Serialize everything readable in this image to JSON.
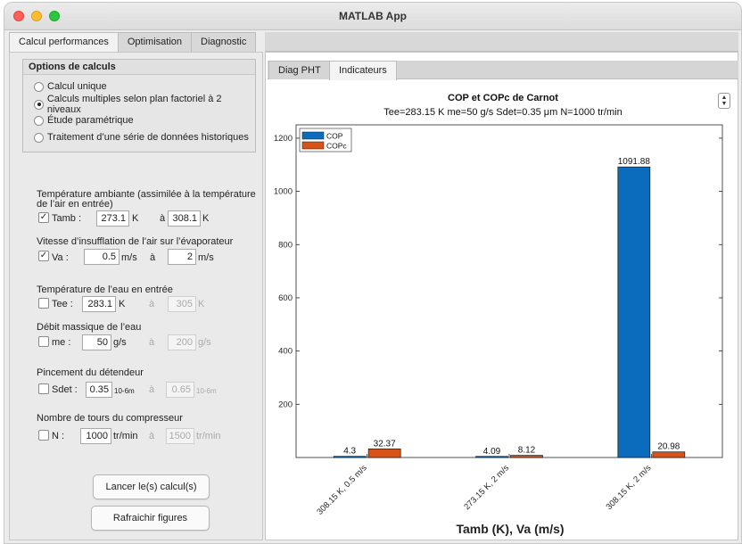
{
  "window": {
    "title": "MATLAB App"
  },
  "main_tabs": [
    {
      "label": "Calcul performances",
      "active": true
    },
    {
      "label": "Optimisation",
      "active": false
    },
    {
      "label": "Diagnostic",
      "active": false
    }
  ],
  "options": {
    "title": "Options de calculs",
    "items": [
      {
        "label": "Calcul unique",
        "selected": false
      },
      {
        "label": "Calculs multiples selon plan factoriel à 2 niveaux",
        "selected": true
      },
      {
        "label": "Étude paramétrique",
        "selected": false
      },
      {
        "label": "Traitement d’une série de données historiques",
        "selected": false
      }
    ]
  },
  "params": {
    "tamb": {
      "section": "Température ambiante (assimilée à la température",
      "section2": "de l’air en entrée)",
      "check": "Tamb :",
      "checked": true,
      "from": "273.1",
      "unit": "K",
      "a": "à",
      "to": "308.1"
    },
    "va": {
      "section": "Vitesse d’insufflation de l’air sur l’évaporateur",
      "check": "Va :",
      "checked": true,
      "from": "0.5",
      "unit": "m/s",
      "a": "à",
      "to": "2"
    },
    "tee": {
      "section": "Température de l’eau en entrée",
      "check": "Tee :",
      "checked": false,
      "from": "283.1",
      "unit": "K",
      "a": "à",
      "to": "305"
    },
    "me": {
      "section": "Débit massique de l’eau",
      "check": "me :",
      "checked": false,
      "from": "50",
      "unit": "g/s",
      "a": "à",
      "to": "200"
    },
    "sdet": {
      "section": "Pincement du détendeur",
      "check": "Sdet :",
      "checked": false,
      "from": "0.35",
      "unit": "10-6m",
      "a": "à",
      "to": "0.65"
    },
    "n": {
      "section": "Nombre de tours du compresseur",
      "check": "N :",
      "checked": false,
      "from": "1000",
      "unit": "tr/min",
      "a": "à",
      "to": "1500"
    }
  },
  "buttons": {
    "run": "Lancer le(s) calcul(s)",
    "refresh": "Rafraichir figures"
  },
  "sub_tabs": [
    {
      "label": "Diag PHT",
      "active": false
    },
    {
      "label": "Indicateurs",
      "active": true
    }
  ],
  "colors": {
    "cop": "#0b6cbd",
    "copc": "#d95319"
  },
  "chart_data": {
    "type": "bar",
    "title": "COP et COPc de Carnot",
    "subtitle": "Tee=283.15 K me=50 g/s Sdet=0.35 μm N=1000 tr/min",
    "xlabel": "Tamb (K), Va (m/s)",
    "ylabel": "",
    "categories": [
      "308.15 K, 0.5 m/s",
      "273.15 K, 2 m/s",
      "308.15 K, 2 m/s"
    ],
    "series": [
      {
        "name": "COP",
        "values": [
          4.3,
          4.09,
          1091.88
        ],
        "labels": [
          "4.3",
          "4.09",
          "1091.88"
        ]
      },
      {
        "name": "COPc",
        "values": [
          32.37,
          8.12,
          20.98
        ],
        "labels": [
          "32.37",
          "8.12",
          "20.98"
        ]
      }
    ],
    "yticks": [
      200,
      400,
      600,
      800,
      1000,
      1200
    ],
    "ylim": [
      0,
      1250
    ],
    "legend": "top-left",
    "grid": false
  }
}
